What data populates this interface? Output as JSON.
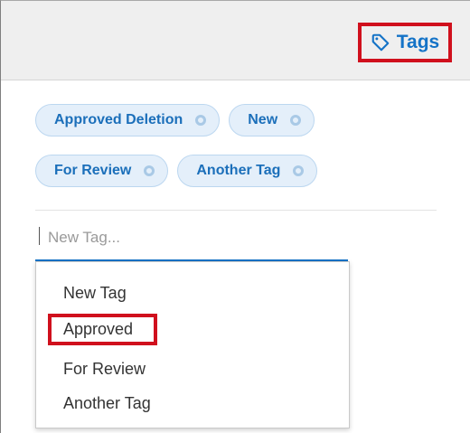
{
  "header": {
    "tags_button_label": "Tags",
    "tags_icon": "tag-icon",
    "highlight_color": "#d0101d",
    "accent_color": "#1473c7"
  },
  "tags": [
    {
      "label": "Approved Deletion"
    },
    {
      "label": "New"
    },
    {
      "label": "For Review"
    },
    {
      "label": "Another Tag"
    }
  ],
  "tag_remove_icon": "remove-tag-icon",
  "new_tag_input": {
    "placeholder": "New Tag...",
    "value": ""
  },
  "suggestions": [
    {
      "label": "New Tag"
    },
    {
      "label": "Approved",
      "highlighted": true
    },
    {
      "label": "For Review"
    },
    {
      "label": "Another Tag"
    }
  ]
}
